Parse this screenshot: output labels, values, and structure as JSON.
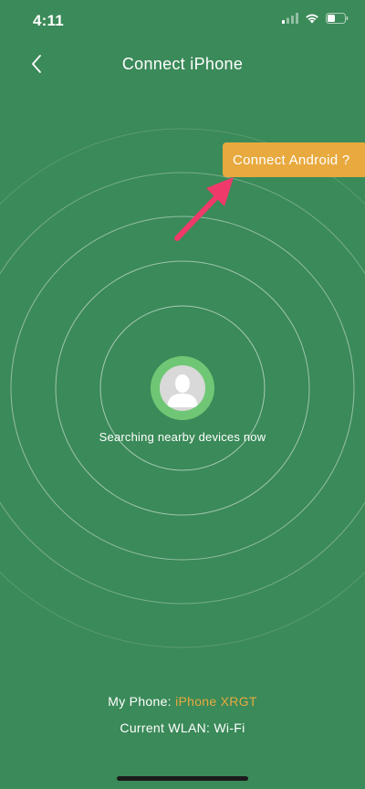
{
  "status_bar": {
    "time": "4:11",
    "icons": [
      "signal-icon",
      "wifi-icon",
      "battery-icon"
    ]
  },
  "header": {
    "title": "Connect iPhone",
    "back_icon": "chevron-left-icon"
  },
  "connect_android": {
    "label": "Connect Android ?"
  },
  "search": {
    "status_text": "Searching nearby devices now",
    "avatar_icon": "person-avatar-icon"
  },
  "footer": {
    "my_phone_label": "My Phone: ",
    "my_phone_name": "iPhone XRGT",
    "wlan_text": "Current WLAN: Wi-Fi"
  },
  "colors": {
    "background": "#3b8a59",
    "accent": "#e8a93e",
    "avatar_ring": "#6fc775",
    "annotation_arrow": "#f0396b"
  }
}
